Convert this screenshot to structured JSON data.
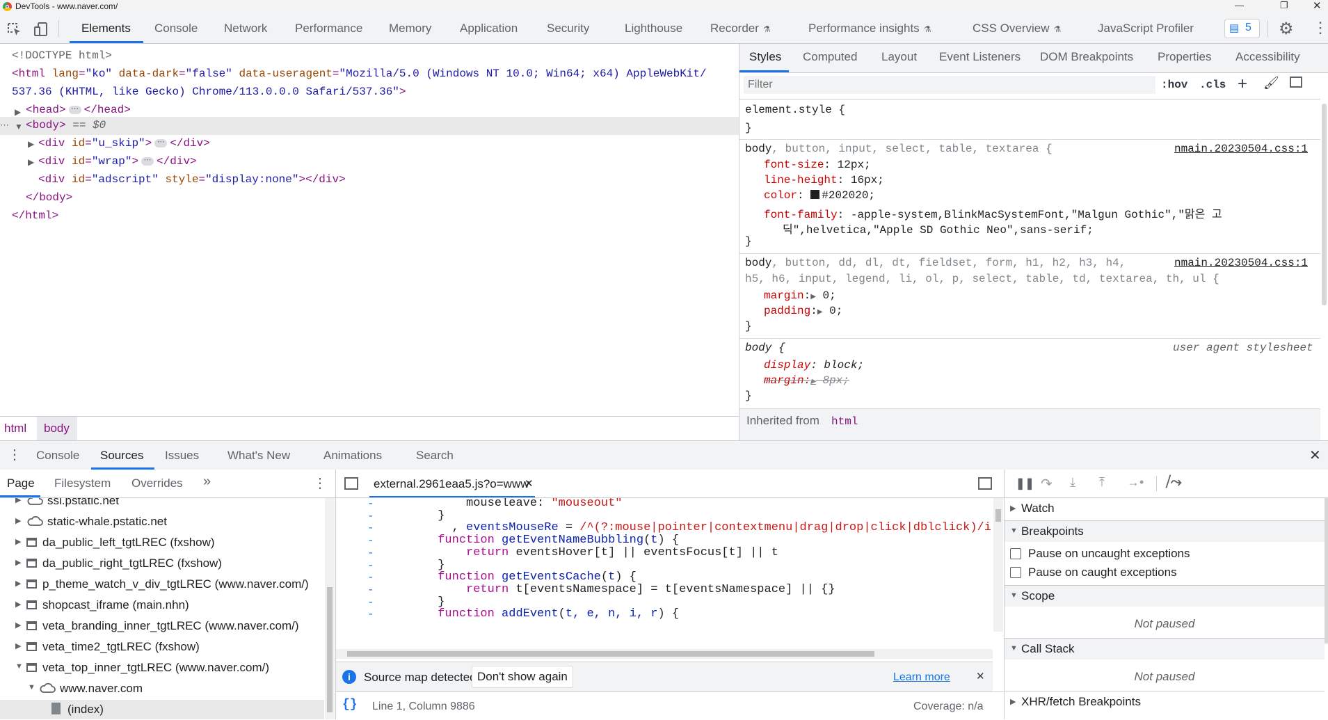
{
  "window": {
    "title": "DevTools - www.naver.com/"
  },
  "main_tabs": [
    "Elements",
    "Console",
    "Network",
    "Performance",
    "Memory",
    "Application",
    "Security",
    "Lighthouse",
    "Recorder",
    "Performance insights",
    "CSS Overview",
    "JavaScript Profiler"
  ],
  "issues_count": "5",
  "elements": {
    "doctype": "<!DOCTYPE html>",
    "html_open_1": {
      "tag_open": "<html ",
      "lang_attr": "lang",
      "lang_val": "\"ko\"",
      "dark_attr": " data-dark",
      "dark_val": "\"false\"",
      "ua_attr": " data-useragent",
      "ua_val_1": "\"Mozilla/5.0 (Windows NT 10.0; Win64; x64) AppleWebKit/"
    },
    "html_open_2": {
      "ua_val_2": "537.36 (KHTML, like Gecko) Chrome/113.0.0.0 Safari/537.36\"",
      "close": ">"
    },
    "head": {
      "open": "<head>",
      "close": "</head>"
    },
    "body": {
      "open": "<body>",
      "marker": " == $0"
    },
    "div1": {
      "open": "<div ",
      "attr": "id",
      "val": "\"u_skip\"",
      "gt": ">",
      "close": "</div>"
    },
    "div2": {
      "open": "<div ",
      "attr": "id",
      "val": "\"wrap\"",
      "gt": ">",
      "close": "</div>"
    },
    "div3": {
      "open": "<div ",
      "attr": "id",
      "val": "\"adscript\"",
      "attr2": " style",
      "val2": "\"display:none\"",
      "rest": "></div>"
    },
    "body_close": "</body>",
    "html_close": "</html>",
    "ellipsis": "⋯"
  },
  "breadcrumbs": [
    "html",
    "body"
  ],
  "styles": {
    "tabs": [
      "Styles",
      "Computed",
      "Layout",
      "Event Listeners",
      "DOM Breakpoints",
      "Properties",
      "Accessibility"
    ],
    "filter_placeholder": "Filter",
    "hov": ":hov",
    "cls": ".cls",
    "rule1": {
      "selector": "element.style {",
      "close": "}"
    },
    "rule2": {
      "selector_main": "body",
      "selector_rest": ", button, input, select, table, textarea {",
      "source": "nmain.20230504.css:1",
      "p1": "font-size",
      "v1": " 12px;",
      "p2": "line-height",
      "v2": " 16px;",
      "p3": "color",
      "v3": "#202020;",
      "swatch": "#202020",
      "p4": "font-family",
      "v4": " -apple-system,BlinkMacSystemFont,\"Malgun Gothic\",\"맑은 고",
      "v4b": "딕\",helvetica,\"Apple SD Gothic Neo\",sans-serif;",
      "close": "}"
    },
    "rule3": {
      "selector_main": "body",
      "selector_rest1": ", button, dd, dl, dt, fieldset, form, h1, h2, h3, h4,",
      "selector_rest2": "h5, h6, input, legend, li, ol, p, select, table, td, textarea, th, ul {",
      "source": "nmain.20230504.css:1",
      "p1": "margin",
      "v1": " 0;",
      "p2": "padding",
      "v2": " 0;",
      "close": "}"
    },
    "rule4": {
      "selector": "body {",
      "source": "user agent stylesheet",
      "p1": "display",
      "v1": " block;",
      "p2": "margin:",
      "v2": " 8px;",
      "close": "}"
    },
    "inherited_label": "Inherited from ",
    "inherited_tag": "html"
  },
  "drawer": {
    "tabs": [
      "Console",
      "Sources",
      "Issues",
      "What's New",
      "Animations",
      "Search"
    ]
  },
  "navigator": {
    "tabs": [
      "Page",
      "Filesystem",
      "Overrides"
    ],
    "more": "»",
    "items": [
      {
        "label": "ssl.pstatic.net",
        "icon": "cloud"
      },
      {
        "label": "static-whale.pstatic.net",
        "icon": "cloud"
      },
      {
        "label": "da_public_left_tgtLREC (fxshow)",
        "icon": "frame"
      },
      {
        "label": "da_public_right_tgtLREC (fxshow)",
        "icon": "frame"
      },
      {
        "label": "p_theme_watch_v_div_tgtLREC (www.naver.com/)",
        "icon": "frame"
      },
      {
        "label": "shopcast_iframe (main.nhn)",
        "icon": "frame"
      },
      {
        "label": "veta_branding_inner_tgtLREC (www.naver.com/)",
        "icon": "frame"
      },
      {
        "label": "veta_time2_tgtLREC (fxshow)",
        "icon": "frame"
      },
      {
        "label": "veta_top_inner_tgtLREC (www.naver.com/)",
        "icon": "frame"
      },
      {
        "label": "www.naver.com",
        "icon": "cloud"
      },
      {
        "label": "(index)",
        "icon": "file"
      }
    ]
  },
  "editor": {
    "file_tab": "external.2961eaa5.js?o=www",
    "lines": [
      {
        "indent": "          ",
        "parts": [
          [
            "mouseleave: ",
            ""
          ],
          [
            "\"mouseout\"",
            "str"
          ]
        ]
      },
      {
        "indent": "      ",
        "parts": [
          [
            "}",
            ""
          ]
        ]
      },
      {
        "indent": "        ",
        "parts": [
          [
            ", ",
            ""
          ],
          [
            "eventsMouseRe",
            "fnn"
          ],
          [
            " = ",
            ""
          ],
          [
            "/^(?:mouse|pointer|contextmenu|drag|drop|click|dblclick)/i",
            "str"
          ],
          [
            ";",
            ""
          ]
        ]
      },
      {
        "indent": "      ",
        "parts": [
          [
            "function ",
            "kw"
          ],
          [
            "getEventNameBubbling",
            "fnn"
          ],
          [
            "(",
            ""
          ],
          [
            "t",
            "fnn"
          ],
          [
            ") {",
            ""
          ]
        ]
      },
      {
        "indent": "          ",
        "parts": [
          [
            "return ",
            "kw"
          ],
          [
            "eventsHover[t] || eventsFocus[t] || t",
            ""
          ]
        ]
      },
      {
        "indent": "      ",
        "parts": [
          [
            "}",
            ""
          ]
        ]
      },
      {
        "indent": "      ",
        "parts": [
          [
            "function ",
            "kw"
          ],
          [
            "getEventsCache",
            "fnn"
          ],
          [
            "(",
            ""
          ],
          [
            "t",
            "fnn"
          ],
          [
            ") {",
            ""
          ]
        ]
      },
      {
        "indent": "          ",
        "parts": [
          [
            "return ",
            "kw"
          ],
          [
            "t[eventsNamespace] = t[eventsNamespace] || {}",
            ""
          ]
        ]
      },
      {
        "indent": "      ",
        "parts": [
          [
            "}",
            ""
          ]
        ]
      },
      {
        "indent": "      ",
        "parts": [
          [
            "function ",
            "kw"
          ],
          [
            "addEvent",
            "fnn"
          ],
          [
            "(",
            ""
          ],
          [
            "t, e, n, i, r",
            "fnn"
          ],
          [
            ") {",
            ""
          ]
        ]
      }
    ],
    "gutter_mark": "-",
    "infobar": {
      "text": "Source map detected.",
      "dont_show": "Don't show again",
      "learn_more": "Learn more"
    },
    "status": {
      "position": "Line 1, Column 9886",
      "coverage": "Coverage: n/a"
    }
  },
  "debugger": {
    "watch": "Watch",
    "breakpoints": "Breakpoints",
    "pause_uncaught": "Pause on uncaught exceptions",
    "pause_caught": "Pause on caught exceptions",
    "scope": "Scope",
    "not_paused_1": "Not paused",
    "call_stack": "Call Stack",
    "not_paused_2": "Not paused",
    "xhr": "XHR/fetch Breakpoints"
  },
  "colors": {
    "accent": "#1a73e8",
    "tag": "#881280",
    "attr_name": "#994500",
    "attr_value": "#1a1aa6",
    "css_prop": "#c80000"
  }
}
